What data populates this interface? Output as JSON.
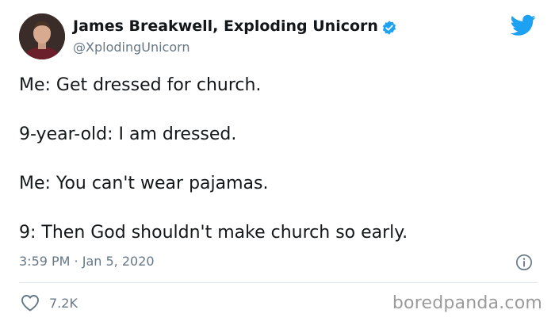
{
  "tweet": {
    "author": {
      "name": "James Breakwell, Exploding Unicorn",
      "handle": "@XplodingUnicorn",
      "verified": true
    },
    "lines": [
      "Me: Get dressed for church.",
      "9-year-old: I am dressed.",
      "Me: You can't wear pajamas.",
      "9: Then God shouldn't make church so early."
    ],
    "timestamp": "3:59 PM · Jan 5, 2020",
    "likes": "7.2K"
  },
  "watermark": "boredpanda.com",
  "colors": {
    "twitter_blue": "#1da1f2",
    "text": "#14171a",
    "secondary_text": "#657786",
    "divider": "#e1e8ed",
    "watermark": "#9a9a9a"
  },
  "icons": {
    "brand": "twitter-bird-icon",
    "verified": "verified-badge-icon",
    "info": "info-icon",
    "like": "heart-icon"
  }
}
